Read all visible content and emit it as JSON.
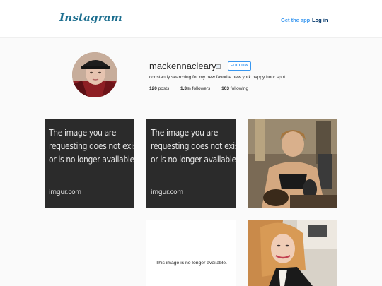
{
  "header": {
    "logo": "Instagram",
    "get_app": "Get the app",
    "login": "Log in"
  },
  "profile": {
    "username": "mackennacleary",
    "follow_label": "FOLLOW",
    "bio": "constantly searching for my new favorite new york happy hour spot.",
    "stats": [
      {
        "count": "120",
        "label": " posts"
      },
      {
        "count": "1.3m",
        "label": " followers"
      },
      {
        "count": "103",
        "label": " following"
      }
    ]
  },
  "posts": {
    "imgur_lines": [
      "The image you are",
      "requesting does not exist",
      "or is no longer available."
    ],
    "imgur_brand": "imgur.com",
    "removed_msg": "This image is no longer available."
  }
}
